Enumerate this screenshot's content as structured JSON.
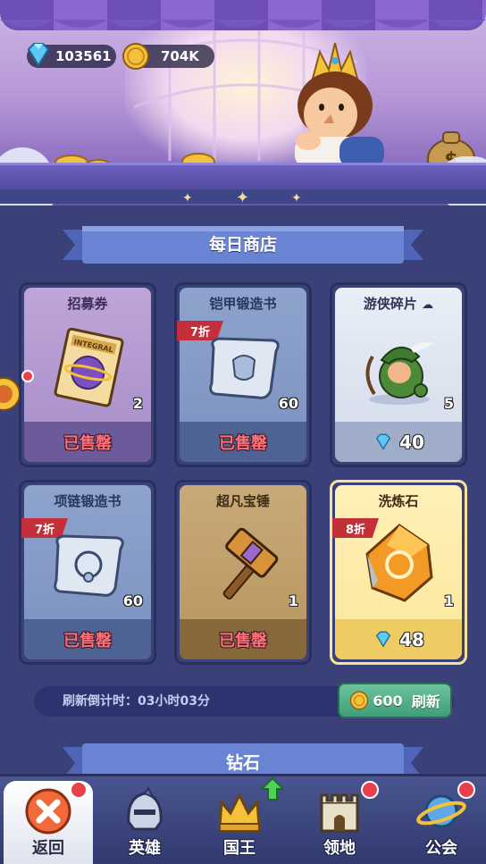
{
  "header": {
    "gems": "103561",
    "gold": "704K"
  },
  "shop": {
    "title": "每日商店",
    "items": [
      {
        "name": "招募券",
        "qty": "2",
        "status": "已售罄",
        "discount": "",
        "price": "",
        "icon": "recruit-ticket-icon"
      },
      {
        "name": "铠甲锻造书",
        "qty": "60",
        "status": "已售罄",
        "discount": "7折",
        "price": "",
        "icon": "armor-scroll-icon"
      },
      {
        "name": "游侠碎片",
        "qty": "5",
        "status": "",
        "discount": "",
        "price": "40",
        "icon": "ranger-shard-icon"
      },
      {
        "name": "项链锻造书",
        "qty": "60",
        "status": "已售罄",
        "discount": "7折",
        "price": "",
        "icon": "necklace-scroll-icon"
      },
      {
        "name": "超凡宝锤",
        "qty": "1",
        "status": "已售罄",
        "discount": "",
        "price": "",
        "icon": "hammer-icon"
      },
      {
        "name": "洗炼石",
        "qty": "1",
        "status": "",
        "discount": "8折",
        "price": "48",
        "icon": "refine-stone-icon"
      }
    ],
    "refresh_countdown": "刷新倒计时：03小时03分",
    "refresh_cost": "600",
    "refresh_label": "刷新"
  },
  "section2": {
    "title": "钻石"
  },
  "nav": [
    {
      "label": "返回",
      "icon": "close-icon",
      "badge": true
    },
    {
      "label": "英雄",
      "icon": "helmet-icon",
      "badge": false
    },
    {
      "label": "国王",
      "icon": "crown-icon",
      "badge": false,
      "upgrade": true
    },
    {
      "label": "领地",
      "icon": "castle-icon",
      "badge": true
    },
    {
      "label": "公会",
      "icon": "planet-icon",
      "badge": true
    }
  ],
  "colors": {
    "background": "#3a4178",
    "sold_out": "#ff6f7a",
    "refresh_button": "#4fae87",
    "discount_tag": "#c4303a"
  }
}
